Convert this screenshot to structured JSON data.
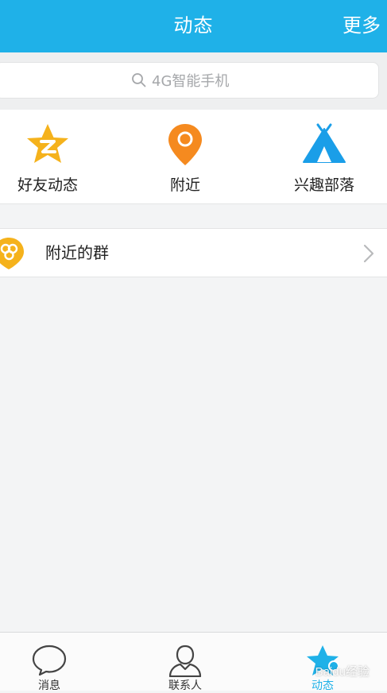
{
  "header": {
    "title": "动态",
    "more_label": "更多"
  },
  "search": {
    "placeholder": "4G智能手机",
    "icon": "search-icon"
  },
  "features": [
    {
      "label": "好友动态",
      "icon": "qzone-star-icon",
      "color": "#f5b21c"
    },
    {
      "label": "附近",
      "icon": "location-pin-icon",
      "color": "#f58a1f"
    },
    {
      "label": "兴趣部落",
      "icon": "tribe-tent-icon",
      "color": "#1a9ee8"
    }
  ],
  "list": [
    {
      "label": "附近的群",
      "icon": "nearby-group-icon",
      "chevron": "chevron-right-icon"
    }
  ],
  "tabbar": [
    {
      "label": "消息",
      "icon": "message-bubble-icon",
      "active": false
    },
    {
      "label": "联系人",
      "icon": "contacts-person-icon",
      "active": false
    },
    {
      "label": "动态",
      "icon": "dynamic-star-icon",
      "active": true
    }
  ],
  "watermark": {
    "text": "Baidu经验"
  },
  "colors": {
    "accent": "#1fb1e8",
    "background": "#f3f4f5"
  }
}
